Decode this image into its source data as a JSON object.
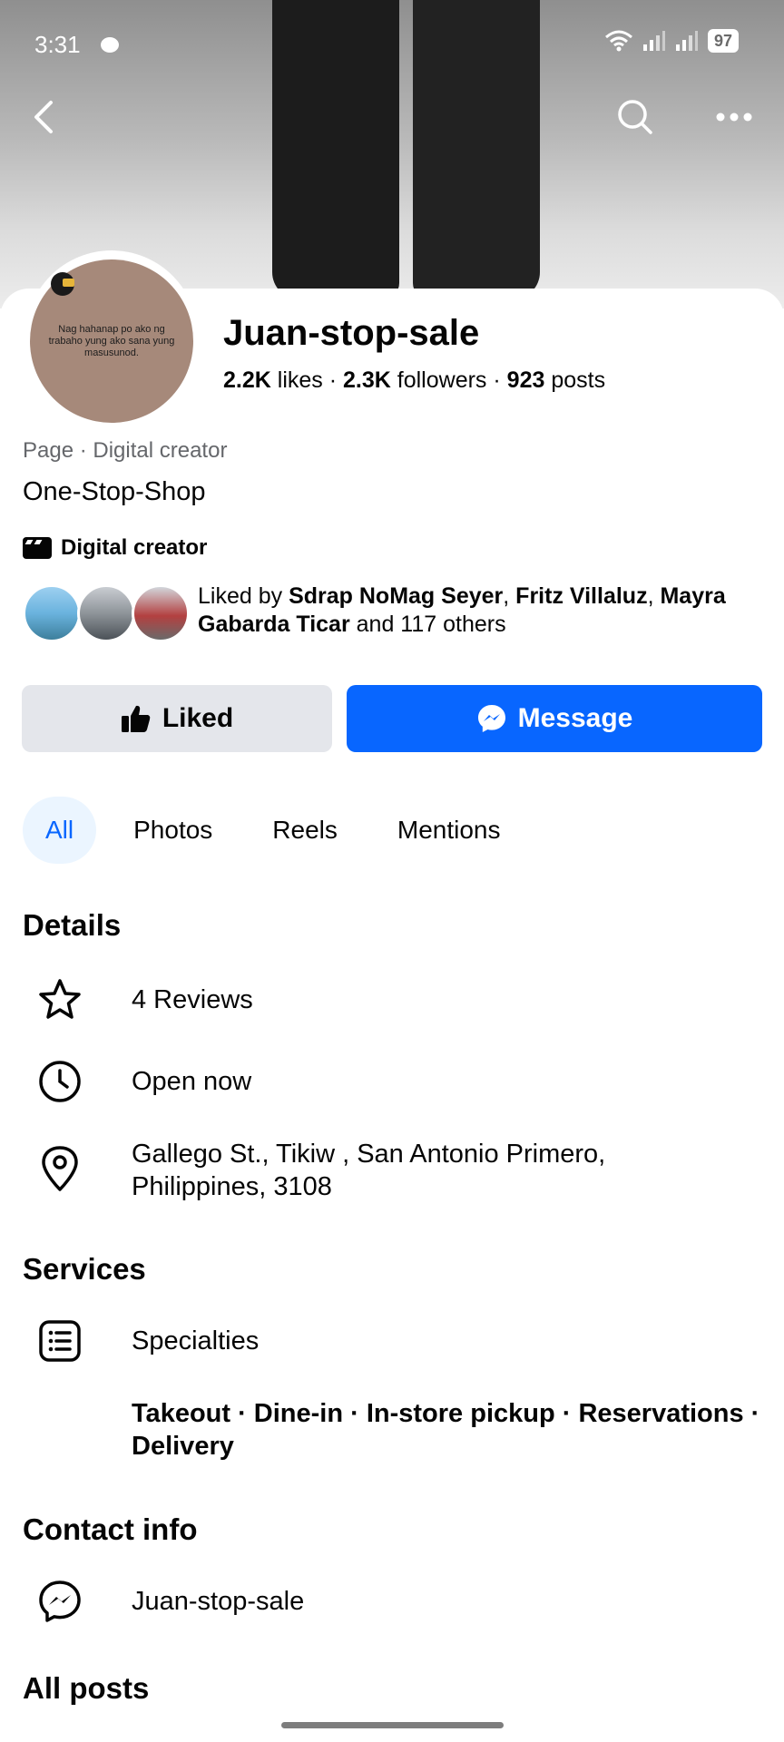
{
  "status_bar": {
    "time": "3:31",
    "battery": "97"
  },
  "profile": {
    "name": "Juan-stop-sale",
    "avatar_text": "Nag hahanap po ako ng trabaho yung ako sana yung masusunod.",
    "stats": {
      "likes_value": "2.2K",
      "likes_label": "likes",
      "followers_value": "2.3K",
      "followers_label": "followers",
      "posts_value": "923",
      "posts_label": "posts",
      "separator": "·"
    },
    "category_line": "Page · Digital creator",
    "bio": "One-Stop-Shop",
    "creator_label": "Digital creator"
  },
  "liked_by": {
    "prefix": "Liked by",
    "name1": "Sdrap NoMag Seyer",
    "name2": "Fritz Villaluz",
    "name3": "Mayra Gabarda Ticar",
    "suffix": "and 117 others"
  },
  "actions": {
    "liked_label": "Liked",
    "message_label": "Message"
  },
  "tabs": [
    {
      "label": "All",
      "active": true
    },
    {
      "label": "Photos"
    },
    {
      "label": "Reels"
    },
    {
      "label": "Mentions"
    }
  ],
  "details": {
    "heading": "Details",
    "reviews": "4 Reviews",
    "hours": "Open now",
    "address_line1": "Gallego St., Tikiw , San Antonio Primero,",
    "address_line2": "Philippines, 3108"
  },
  "services": {
    "heading": "Services",
    "specialties_label": "Specialties",
    "list_line1": "Takeout · Dine-in · In-store pickup · Reservations ·",
    "list_line2": "Delivery"
  },
  "contact": {
    "heading": "Contact info",
    "messenger": "Juan-stop-sale"
  },
  "all_posts_heading": "All posts",
  "colors": {
    "primary": "#0866ff",
    "secondary_button": "#e4e6eb",
    "active_tab_bg": "#ebf5ff",
    "muted_text": "#65676b"
  }
}
